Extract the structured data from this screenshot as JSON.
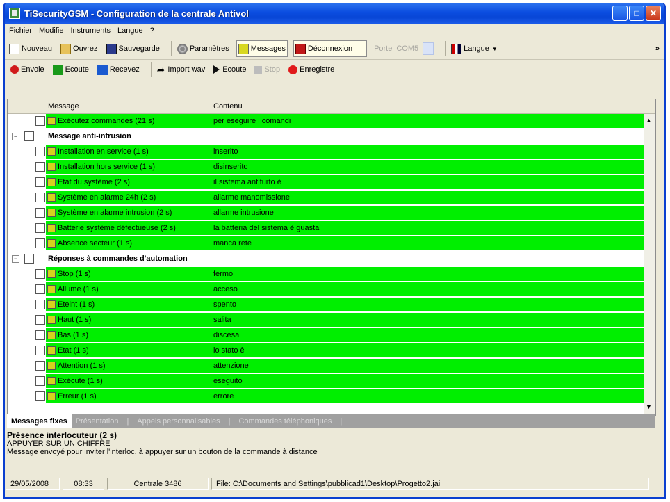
{
  "window": {
    "title": "TiSecurityGSM - Configuration de la centrale Antivol"
  },
  "menu": [
    "Fichier",
    "Modifie",
    "Instruments",
    "Langue",
    "?"
  ],
  "toolbar1": {
    "new": "Nouveau",
    "open": "Ouvrez",
    "save": "Sauvegarde",
    "params": "Paramètres",
    "messages": "Messages",
    "disconnect": "Déconnexion",
    "port_label": "Porte",
    "port_value": "COM5",
    "langue": "Langue",
    "more": "»"
  },
  "toolbar2": {
    "send": "Envoie",
    "listen": "Ecoute",
    "receive": "Recevez",
    "import": "Import wav",
    "play": "Ecoute",
    "stop": "Stop",
    "record": "Enregistre"
  },
  "grid": {
    "col_message": "Message",
    "col_content": "Contenu",
    "rows": [
      {
        "type": "item",
        "message": "Exécutez commandes (21 s)",
        "content": "per eseguire i comandi"
      },
      {
        "type": "group",
        "label": "Message anti-intrusion"
      },
      {
        "type": "item",
        "message": "Installation en service (1 s)",
        "content": "inserito"
      },
      {
        "type": "item",
        "message": "Installation hors service (1 s)",
        "content": "disinserito"
      },
      {
        "type": "item",
        "message": "Etat du système (2 s)",
        "content": "il sistema antifurto è"
      },
      {
        "type": "item",
        "message": "Système en alarme 24h (2 s)",
        "content": "allarme manomissione"
      },
      {
        "type": "item",
        "message": "Système en alarme intrusion (2 s)",
        "content": "allarme intrusione"
      },
      {
        "type": "item",
        "message": "Batterie système défectueuse (2 s)",
        "content": "la batteria del sistema è guasta"
      },
      {
        "type": "item",
        "message": "Absence secteur (1 s)",
        "content": "manca rete"
      },
      {
        "type": "group",
        "label": "Réponses à commandes d'automation"
      },
      {
        "type": "item",
        "message": "Stop (1 s)",
        "content": "fermo"
      },
      {
        "type": "item",
        "message": "Allumé (1 s)",
        "content": "acceso"
      },
      {
        "type": "item",
        "message": "Eteint (1 s)",
        "content": "spento"
      },
      {
        "type": "item",
        "message": "Haut (1 s)",
        "content": "salita"
      },
      {
        "type": "item",
        "message": "Bas (1 s)",
        "content": "discesa"
      },
      {
        "type": "item",
        "message": "Etat (1 s)",
        "content": "lo stato è"
      },
      {
        "type": "item",
        "message": "Attention (1 s)",
        "content": "attenzione"
      },
      {
        "type": "item",
        "message": "Exécuté (1 s)",
        "content": "eseguito"
      },
      {
        "type": "item",
        "message": "Erreur (1 s)",
        "content": "errore"
      }
    ]
  },
  "tabs": [
    "Messages fixes",
    "Présentation",
    "Appels personnalisables",
    "Commandes téléphoniques"
  ],
  "info": {
    "title": "Présence interlocuteur (2 s)",
    "line1": "APPUYER SUR UN CHIFFRE",
    "line2": "Message envoyé pour inviter l'interloc. à appuyer sur un bouton de la commande à distance"
  },
  "status": {
    "date": "29/05/2008",
    "time": "08:33",
    "centrale": "Centrale 3486",
    "file": "File: C:\\Documents and Settings\\pubblicad1\\Desktop\\Progetto2.jai"
  },
  "colors": {
    "row_green": "#00ef00",
    "title_blue": "#0b4de0"
  }
}
